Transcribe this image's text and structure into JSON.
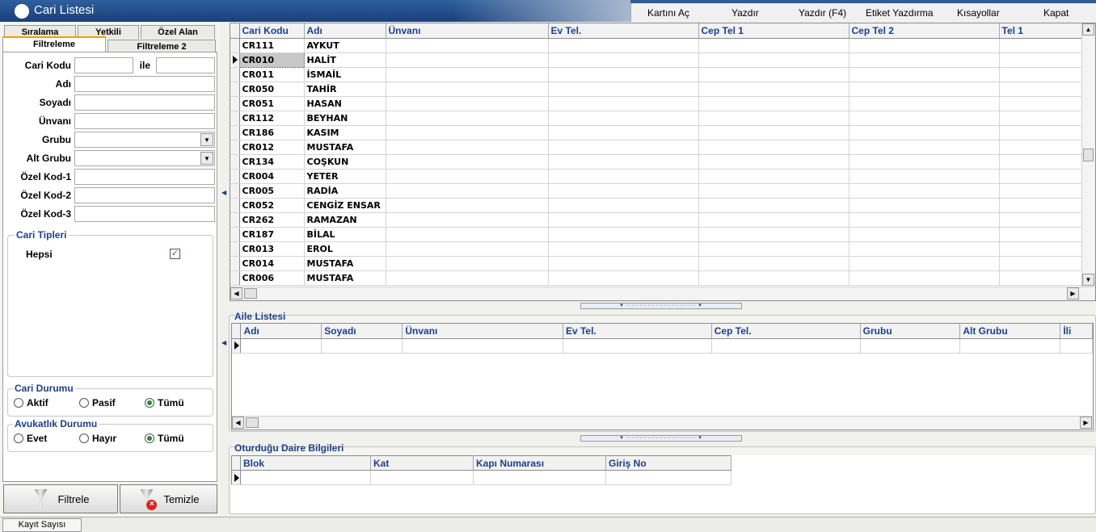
{
  "app": {
    "title": "Cari Listesi"
  },
  "menu": {
    "open": "Kartını Aç",
    "print": "Yazdır",
    "print_f4": "Yazdır (F4)",
    "label_print": "Etiket Yazdırma",
    "shortcuts": "Kısayollar",
    "close": "Kapat"
  },
  "filter": {
    "tabs": {
      "sort": "Sıralama",
      "auth": "Yetkili",
      "custom": "Özel Alan",
      "filter1": "Filtreleme",
      "filter2": "Filtreleme 2"
    },
    "labels": {
      "code": "Cari Kodu",
      "range": "ile",
      "name": "Adı",
      "surname": "Soyadı",
      "title": "Ünvanı",
      "group": "Grubu",
      "subgroup": "Alt Grubu",
      "code1": "Özel Kod-1",
      "code2": "Özel Kod-2",
      "code3": "Özel Kod-3"
    },
    "types": {
      "title": "Cari Tipleri",
      "all": "Hepsi",
      "all_checked": true
    },
    "status": {
      "title": "Cari Durumu",
      "active": "Aktif",
      "passive": "Pasif",
      "all": "Tümü",
      "selected": "all"
    },
    "lawyer": {
      "title": "Avukatlık Durumu",
      "yes": "Evet",
      "no": "Hayır",
      "all": "Tümü",
      "selected": "all"
    },
    "buttons": {
      "filter": "Filtrele",
      "clear": "Temizle"
    }
  },
  "main_grid": {
    "columns": [
      "Cari Kodu",
      "Adı",
      "Ünvanı",
      "Ev Tel.",
      "Cep Tel 1",
      "Cep Tel 2",
      "Tel 1"
    ],
    "rows": [
      [
        "CR111",
        "AYKUT"
      ],
      [
        "CR010",
        "HALİT"
      ],
      [
        "CR011",
        "İSMAİL"
      ],
      [
        "CR050",
        "TAHİR"
      ],
      [
        "CR051",
        "HASAN"
      ],
      [
        "CR112",
        "BEYHAN"
      ],
      [
        "CR186",
        "KASIM"
      ],
      [
        "CR012",
        "MUSTAFA"
      ],
      [
        "CR134",
        "COŞKUN"
      ],
      [
        "CR004",
        "YETER"
      ],
      [
        "CR005",
        "RADİA"
      ],
      [
        "CR052",
        "CENGİZ ENSAR"
      ],
      [
        "CR262",
        "RAMAZAN"
      ],
      [
        "CR187",
        "BİLAL"
      ],
      [
        "CR013",
        "EROL"
      ],
      [
        "CR014",
        "MUSTAFA"
      ],
      [
        "CR006",
        "MUSTAFA"
      ]
    ],
    "selected_row": 1
  },
  "family": {
    "title": "Aile Listesi",
    "columns": [
      "Adı",
      "Soyadı",
      "Ünvanı",
      "Ev Tel.",
      "Cep Tel.",
      "Grubu",
      "Alt Grubu",
      "İli"
    ]
  },
  "residence": {
    "title": "Oturduğu Daire Bilgileri",
    "columns": [
      "Blok",
      "Kat",
      "Kapı Numarası",
      "Giriş No"
    ]
  },
  "status_bar": {
    "record_count": "Kayıt Sayısı"
  }
}
